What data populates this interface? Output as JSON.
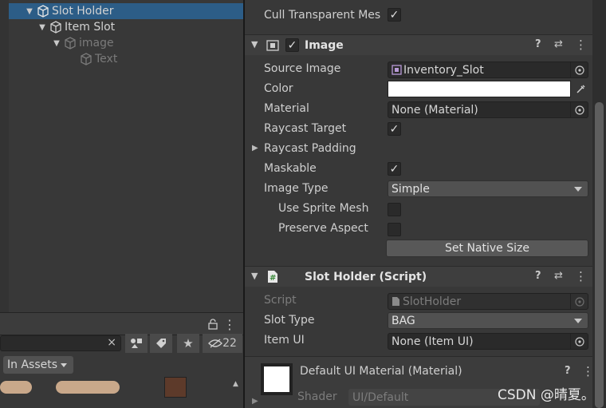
{
  "hierarchy": {
    "items": [
      {
        "label": "Slot Holder"
      },
      {
        "label": "Item Slot"
      },
      {
        "label": "image"
      },
      {
        "label": "Text"
      }
    ]
  },
  "project": {
    "filter_label": "In Assets",
    "hidden_count": "22",
    "clear_search": "×"
  },
  "inspector": {
    "cull_label": "Cull Transparent Mes",
    "image_component": {
      "title": "Image",
      "source_image_label": "Source Image",
      "source_image_value": "Inventory_Slot",
      "color_label": "Color",
      "material_label": "Material",
      "material_value": "None (Material)",
      "raycast_target_label": "Raycast Target",
      "raycast_padding_label": "Raycast Padding",
      "maskable_label": "Maskable",
      "image_type_label": "Image Type",
      "image_type_value": "Simple",
      "use_sprite_mesh_label": "Use Sprite Mesh",
      "preserve_aspect_label": "Preserve Aspect",
      "set_native_size_label": "Set Native Size"
    },
    "script_component": {
      "title": "Slot Holder (Script)",
      "script_label": "Script",
      "script_value": "SlotHolder",
      "slot_type_label": "Slot Type",
      "slot_type_value": "BAG",
      "item_ui_label": "Item UI",
      "item_ui_value": "None (Item UI)"
    },
    "material_section": {
      "title": "Default UI Material (Material)",
      "shader_label": "Shader",
      "shader_value": "UI/Default"
    }
  },
  "watermark": "CSDN @晴夏。",
  "colors": {
    "selection": "#2c5d87",
    "panel_bg": "#383838",
    "field_bg": "#2a2a2a"
  }
}
